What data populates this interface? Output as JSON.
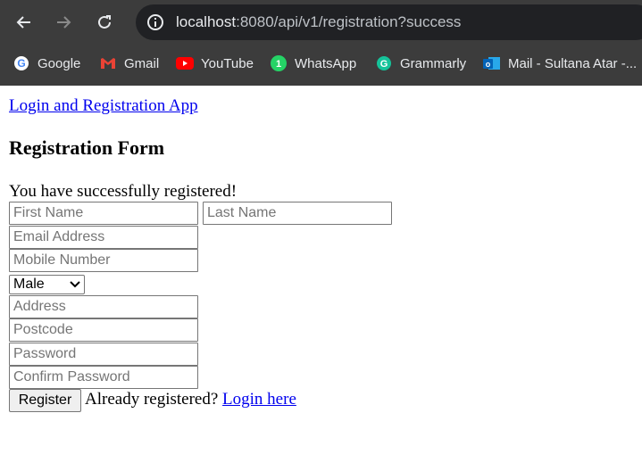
{
  "browser": {
    "url_host": "localhost",
    "url_path": ":8080/api/v1/registration?success",
    "bookmarks": [
      "Google",
      "Gmail",
      "YouTube",
      "WhatsApp",
      "Grammarly",
      "Mail - Sultana Atar -..."
    ]
  },
  "page": {
    "app_link": "Login and Registration App",
    "heading": "Registration Form",
    "success_message": "You have successfully registered!",
    "fields": {
      "first_name": "First Name",
      "last_name": "Last Name",
      "email": "Email Address",
      "mobile": "Mobile Number",
      "address": "Address",
      "postcode": "Postcode",
      "password": "Password",
      "confirm_password": "Confirm Password"
    },
    "gender_selected": "Male",
    "register_button": "Register",
    "already_text": "Already registered?",
    "login_link": "Login here"
  },
  "colors": {
    "link": "#0000ee",
    "chrome_bg": "#3c3c3c",
    "omnibox_bg": "#202124"
  }
}
